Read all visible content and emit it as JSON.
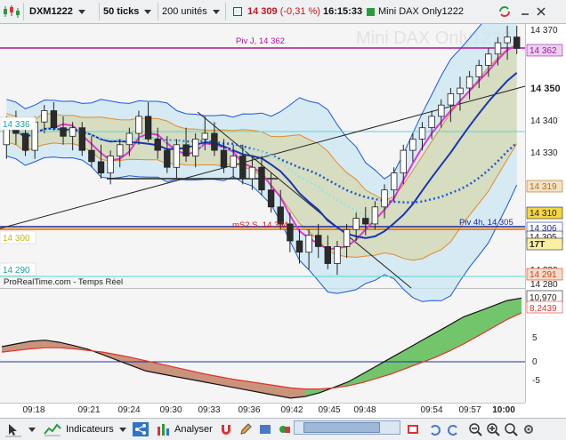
{
  "toolbar": {
    "instrument": "DXM1222",
    "interval": "50 ticks",
    "units": "200 unités",
    "price": "14 309",
    "change": "(-0,31 %)",
    "time": "16:15:33",
    "title": "Mini DAX Only1222"
  },
  "watermark": "Mini DAX Only1222",
  "source_label": "ProRealTime.com - Temps Réel",
  "price_axis": {
    "ticks": [
      "14 370",
      "14 350",
      "14 340",
      "14 330",
      "14 310",
      "14 300",
      "14 290",
      "14 280"
    ],
    "markers": [
      {
        "label": "14 362",
        "bg": "#e9d1ef",
        "fg": "#a4179d"
      },
      {
        "label": "14 319",
        "bg": "#f3e2c8",
        "fg": "#b86d11"
      },
      {
        "label": "14 310",
        "bg": "#f3d640",
        "fg": "#222222"
      },
      {
        "label": "14 306",
        "bg": "#ffffff",
        "fg": "#1c2a9b"
      },
      {
        "label": "14 305",
        "bg": "#ffffff",
        "fg": "#222222"
      },
      {
        "label": "17T",
        "bg": "#fbf0a2",
        "fg": "#222222"
      },
      {
        "label": "14 291",
        "bg": "#f2dccc",
        "fg": "#d34316"
      },
      {
        "label": "14 286",
        "bg": "#dbe9f6",
        "fg": "#1b4fa2"
      },
      {
        "label": "14 285",
        "bg": "#dbe9f6",
        "fg": "#1b4fa2"
      }
    ],
    "left_markers": [
      {
        "label": "14 336",
        "fg": "#1aa39e"
      },
      {
        "label": "14 300",
        "fg": "#c8b70c"
      },
      {
        "label": "14 290",
        "fg": "#1aa39e"
      }
    ]
  },
  "annotations": {
    "pivj": "Piv J, 14 362",
    "piv4h": "Piv 4h, 14 305",
    "ms2": "mS2 S. 14 304"
  },
  "macd_axis": {
    "ticks": [
      "10,970",
      "8,2439",
      "5",
      "0",
      "-5"
    ]
  },
  "x_axis": {
    "ticks": [
      "09:18",
      "09:21",
      "09:24",
      "09:30",
      "09:33",
      "09:36",
      "09:42",
      "09:45",
      "09:48",
      "09:54",
      "09:57",
      "10:00"
    ]
  },
  "bottombar": {
    "indicators_label": "Indicateurs",
    "analyse_label": "Analyser"
  },
  "colors": {
    "accent_red": "#c8151b",
    "pivot_magenta": "#b0139f",
    "pivot_blue": "#1c2a9b",
    "up_candle": "#ffffff",
    "down_candle": "#2b2b2b"
  },
  "chart_data": {
    "type": "candlestick",
    "y_range": [
      14280,
      14372
    ],
    "candles": [
      [
        14330,
        14340,
        14325,
        14336
      ],
      [
        14336,
        14342,
        14330,
        14334
      ],
      [
        14334,
        14338,
        14326,
        14328
      ],
      [
        14328,
        14340,
        14325,
        14338
      ],
      [
        14338,
        14344,
        14334,
        14342
      ],
      [
        14342,
        14345,
        14335,
        14336
      ],
      [
        14336,
        14340,
        14330,
        14333
      ],
      [
        14333,
        14338,
        14328,
        14336
      ],
      [
        14336,
        14338,
        14326,
        14328
      ],
      [
        14328,
        14333,
        14322,
        14324
      ],
      [
        14324,
        14330,
        14318,
        14320
      ],
      [
        14320,
        14328,
        14316,
        14326
      ],
      [
        14326,
        14332,
        14322,
        14330
      ],
      [
        14330,
        14336,
        14326,
        14334
      ],
      [
        14334,
        14342,
        14330,
        14340
      ],
      [
        14340,
        14345,
        14331,
        14332
      ],
      [
        14332,
        14336,
        14325,
        14328
      ],
      [
        14328,
        14333,
        14320,
        14322
      ],
      [
        14322,
        14332,
        14318,
        14330
      ],
      [
        14330,
        14336,
        14324,
        14326
      ],
      [
        14326,
        14334,
        14322,
        14332
      ],
      [
        14332,
        14340,
        14328,
        14334
      ],
      [
        14334,
        14338,
        14326,
        14328
      ],
      [
        14328,
        14332,
        14320,
        14322
      ],
      [
        14322,
        14330,
        14318,
        14326
      ],
      [
        14326,
        14330,
        14316,
        14318
      ],
      [
        14318,
        14326,
        14314,
        14322
      ],
      [
        14322,
        14326,
        14312,
        14314
      ],
      [
        14314,
        14320,
        14306,
        14308
      ],
      [
        14308,
        14314,
        14300,
        14302
      ],
      [
        14302,
        14306,
        14292,
        14296
      ],
      [
        14296,
        14300,
        14288,
        14292
      ],
      [
        14292,
        14300,
        14286,
        14298
      ],
      [
        14298,
        14302,
        14290,
        14294
      ],
      [
        14294,
        14298,
        14286,
        14288
      ],
      [
        14288,
        14296,
        14284,
        14294
      ],
      [
        14294,
        14302,
        14290,
        14300
      ],
      [
        14300,
        14306,
        14296,
        14304
      ],
      [
        14304,
        14308,
        14298,
        14302
      ],
      [
        14302,
        14310,
        14300,
        14308
      ],
      [
        14308,
        14316,
        14304,
        14314
      ],
      [
        14314,
        14322,
        14310,
        14320
      ],
      [
        14320,
        14330,
        14316,
        14328
      ],
      [
        14328,
        14334,
        14324,
        14332
      ],
      [
        14332,
        14338,
        14328,
        14336
      ],
      [
        14336,
        14342,
        14332,
        14340
      ],
      [
        14340,
        14346,
        14336,
        14344
      ],
      [
        14344,
        14350,
        14338,
        14348
      ],
      [
        14348,
        14354,
        14342,
        14350
      ],
      [
        14350,
        14356,
        14346,
        14354
      ],
      [
        14354,
        14360,
        14350,
        14358
      ],
      [
        14358,
        14364,
        14354,
        14362
      ],
      [
        14362,
        14368,
        14358,
        14366
      ],
      [
        14366,
        14372,
        14360,
        14368
      ],
      [
        14368,
        14372,
        14362,
        14364
      ]
    ],
    "macd_range": [
      -8,
      12
    ],
    "macd": [
      2,
      2.5,
      3,
      3.2,
      2.8,
      2.2,
      1.5,
      0.5,
      -0.5,
      -1.5,
      -2.5,
      -3,
      -3.5,
      -4,
      -4.5,
      -5,
      -5.5,
      -6,
      -6.5,
      -7,
      -7.5,
      -7.2,
      -6.5,
      -5.5,
      -4.5,
      -3,
      -1.5,
      0,
      1.5,
      3,
      4.5,
      6,
      7.5,
      8.5,
      9.5,
      10.5,
      10.97
    ],
    "signal": [
      1,
      1.3,
      1.6,
      1.8,
      1.8,
      1.6,
      1.3,
      1,
      0.5,
      0,
      -0.6,
      -1.2,
      -1.8,
      -2.4,
      -3,
      -3.5,
      -4,
      -4.4,
      -4.8,
      -5.2,
      -5.6,
      -5.8,
      -5.8,
      -5.6,
      -5.2,
      -4.6,
      -3.8,
      -3,
      -2,
      -1,
      0,
      1.2,
      2.5,
      4,
      5.5,
      7,
      8.2439
    ]
  }
}
